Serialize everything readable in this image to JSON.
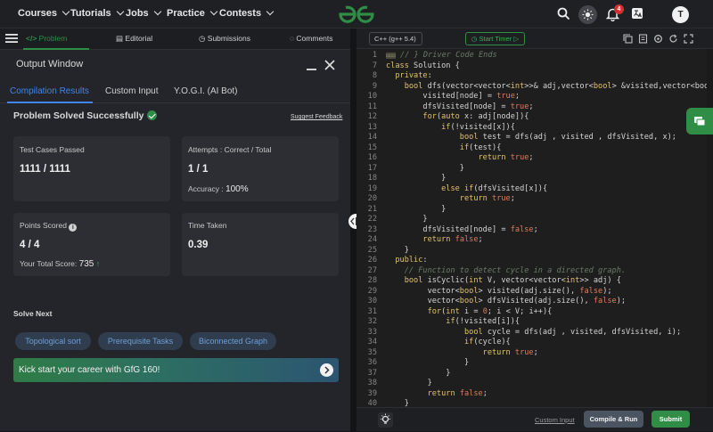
{
  "nav": {
    "items": [
      "Courses",
      "Tutorials",
      "Jobs",
      "Practice",
      "Contests"
    ],
    "notification_count": "4",
    "avatar_initial": "T"
  },
  "left_tabs": [
    "Problem",
    "Editorial",
    "Submissions",
    "Comments"
  ],
  "output_window": {
    "title": "Output Window",
    "tabs": [
      "Compilation Results",
      "Custom Input",
      "Y.O.G.I. (AI Bot)"
    ],
    "status": "Problem Solved Successfully",
    "feedback_link": "Suggest Feedback",
    "cards": {
      "test_cases": {
        "label": "Test Cases Passed",
        "value": "1111 / 1111"
      },
      "attempts": {
        "label": "Attempts : Correct / Total",
        "value": "1 / 1",
        "accuracy_label": "Accuracy :",
        "accuracy_value": "100%"
      },
      "points": {
        "label": "Points Scored",
        "value": "4 / 4",
        "total_label": "Your Total Score:",
        "total_value": "735"
      },
      "time": {
        "label": "Time Taken",
        "value": "0.39"
      }
    },
    "solve_next_title": "Solve Next",
    "solve_next": [
      "Topological sort",
      "Prerequisite Tasks",
      "Biconnected Graph"
    ],
    "banner": "Kick start your career with GfG 160!"
  },
  "editor": {
    "language": "C++ (g++ 5.4)",
    "timer_label": "Start Timer",
    "line_numbers": [
      "1",
      "7",
      "8",
      "9",
      "10",
      "11",
      "12",
      "13",
      "14",
      "15",
      "16",
      "17",
      "18",
      "19",
      "20",
      "21",
      "22",
      "23",
      "24",
      "25",
      "26",
      "27",
      "28",
      "29",
      "30",
      "31",
      "32",
      "33",
      "34",
      "35",
      "36",
      "37",
      "38",
      "39",
      "40"
    ],
    "custom_input_link": "Custom Input",
    "run_button": "Compile & Run",
    "submit_button": "Submit"
  },
  "colors": {
    "brand_green": "#2f8d46",
    "active_blue": "#3f86e8"
  }
}
